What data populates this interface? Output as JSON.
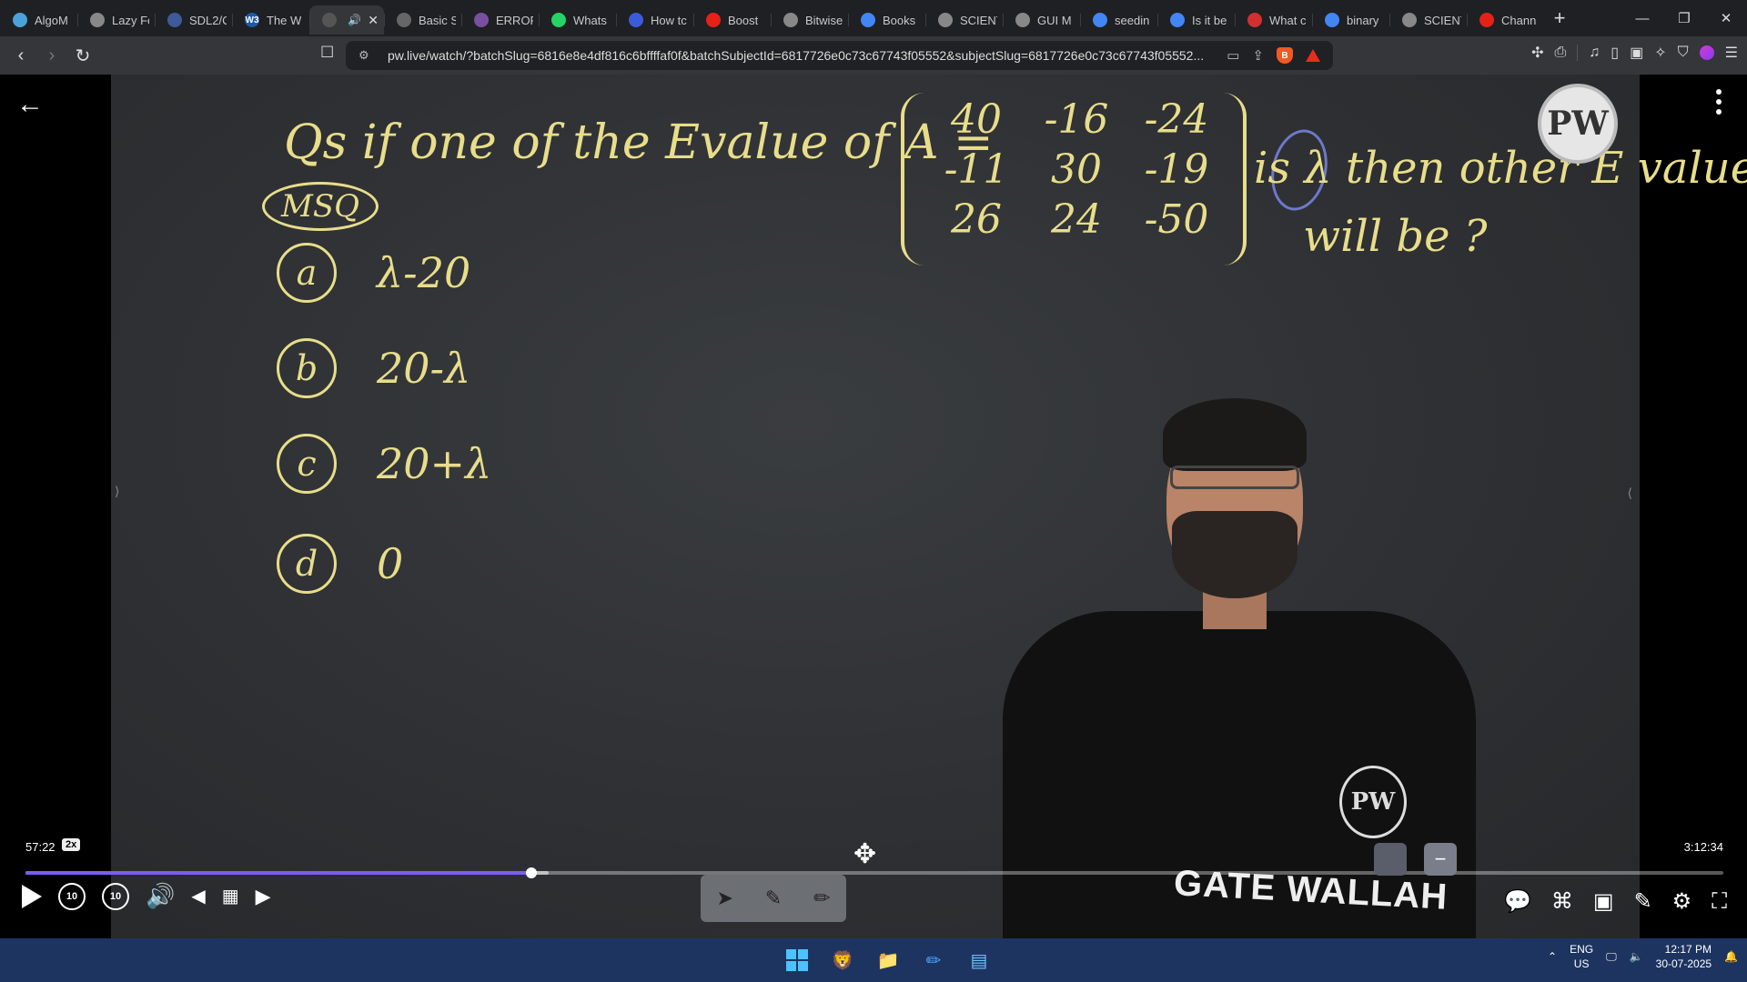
{
  "browser": {
    "tabs": [
      {
        "label": "AlgoM",
        "favicon_color": "#4aa3d8"
      },
      {
        "label": "Lazy Fe",
        "favicon_color": "#888888"
      },
      {
        "label": "SDL2/C",
        "favicon_color": "#3d5a99"
      },
      {
        "label": "The W",
        "favicon_color": "#1e5aa8",
        "favicon_text": "W3"
      },
      {
        "label": "",
        "active": true,
        "favicon_color": "#555555"
      },
      {
        "label": "Basic S",
        "favicon_color": "#666666"
      },
      {
        "label": "ERROR",
        "favicon_color": "#7a4fa0"
      },
      {
        "label": "Whats",
        "favicon_color": "#25d366"
      },
      {
        "label": "How tc",
        "favicon_color": "#3b5bdb"
      },
      {
        "label": "Boost",
        "favicon_color": "#e62117"
      },
      {
        "label": "Bitwise",
        "favicon_color": "#888888"
      },
      {
        "label": "Books",
        "favicon_color": "#4285f4"
      },
      {
        "label": "SCIENT",
        "favicon_color": "#888888"
      },
      {
        "label": "GUI M",
        "favicon_color": "#888888"
      },
      {
        "label": "seedin",
        "favicon_color": "#4285f4"
      },
      {
        "label": "Is it be",
        "favicon_color": "#4285f4"
      },
      {
        "label": "What c",
        "favicon_color": "#d13030"
      },
      {
        "label": "binary",
        "favicon_color": "#4285f4"
      },
      {
        "label": "SCIENT",
        "favicon_color": "#888888"
      },
      {
        "label": "Chann",
        "favicon_color": "#e62117"
      }
    ],
    "new_tab": "+",
    "url": "pw.live/watch/?batchSlug=6816e8e4df816c6bffffaf0f&batchSubjectId=6817726e0c73c67743f05552&subjectSlug=6817726e0c73c67743f05552..."
  },
  "video": {
    "board": {
      "question": "Qs if one of the Evalue of A =",
      "question_tag": "MSQ",
      "matrix": [
        "40",
        "-16",
        "-24",
        "-11",
        "30",
        "-19",
        "26",
        "24",
        "-50"
      ],
      "question_tail": "is λ then other E values",
      "question_tail2": "will be ?",
      "options": [
        {
          "letter": "a",
          "text": "λ-20"
        },
        {
          "letter": "b",
          "text": "20-λ"
        },
        {
          "letter": "c",
          "text": "20+λ"
        },
        {
          "letter": "d",
          "text": "0"
        }
      ],
      "watermark": "PW"
    },
    "shirt_logo": "PW",
    "shirt_text": "GATE WALLAH",
    "current_time": "57:22",
    "playback_speed": "2x",
    "total_time": "3:12:34",
    "progress_fraction": 0.298,
    "seek_back": "10",
    "seek_forward": "10"
  },
  "taskbar": {
    "lang_line1": "ENG",
    "lang_line2": "US",
    "time": "12:17 PM",
    "date": "30-07-2025"
  }
}
